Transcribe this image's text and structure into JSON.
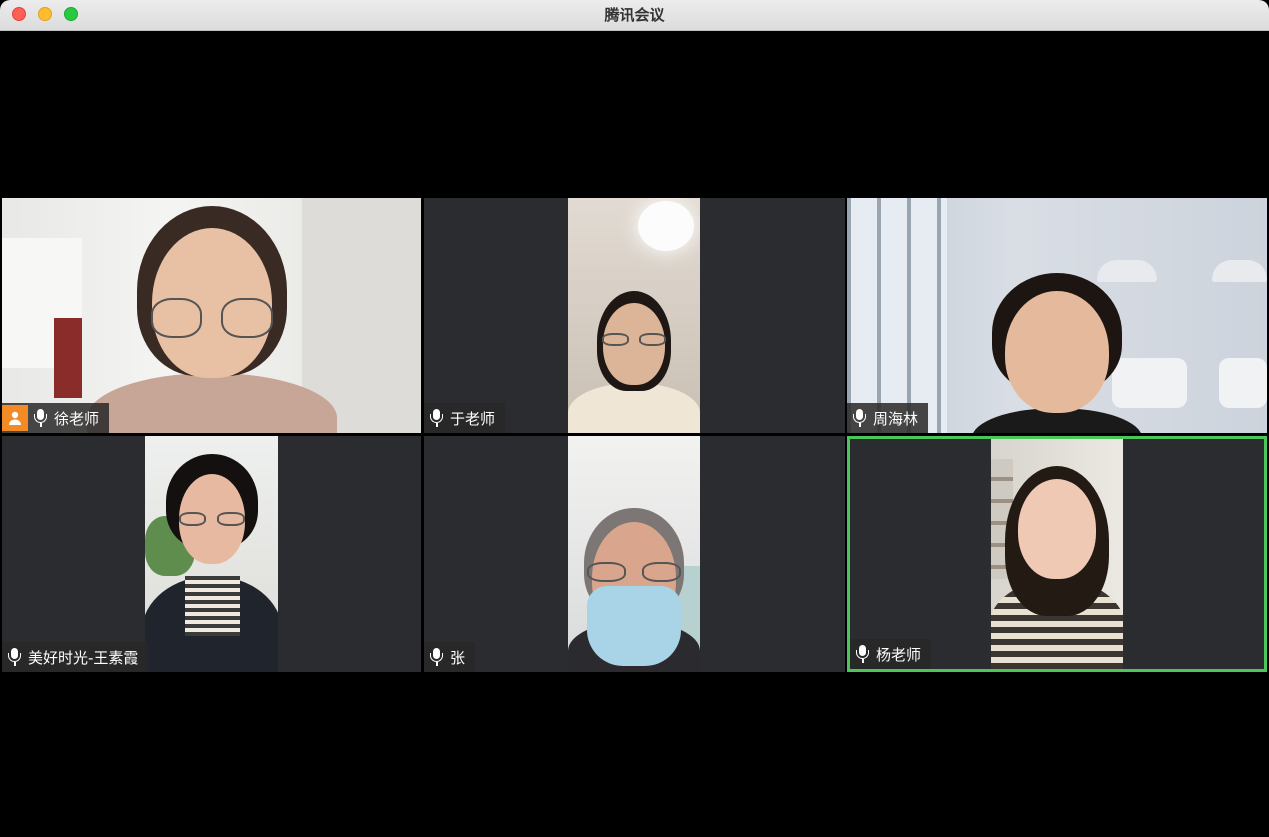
{
  "window": {
    "title": "腾讯会议"
  },
  "participants": [
    {
      "name": "徐老师",
      "host": true,
      "active": false
    },
    {
      "name": "于老师",
      "host": false,
      "active": false
    },
    {
      "name": "周海林",
      "host": false,
      "active": false
    },
    {
      "name": "美好时光-王素霞",
      "host": false,
      "active": false
    },
    {
      "name": "张",
      "host": false,
      "active": false
    },
    {
      "name": "杨老师",
      "host": false,
      "active": true
    }
  ],
  "colors": {
    "tile_background": "#2b2c2f",
    "active_speaker_border": "#4cc55a",
    "host_badge": "#f28b26"
  },
  "icons": {
    "mic": "microphone-icon",
    "host": "person-icon"
  }
}
